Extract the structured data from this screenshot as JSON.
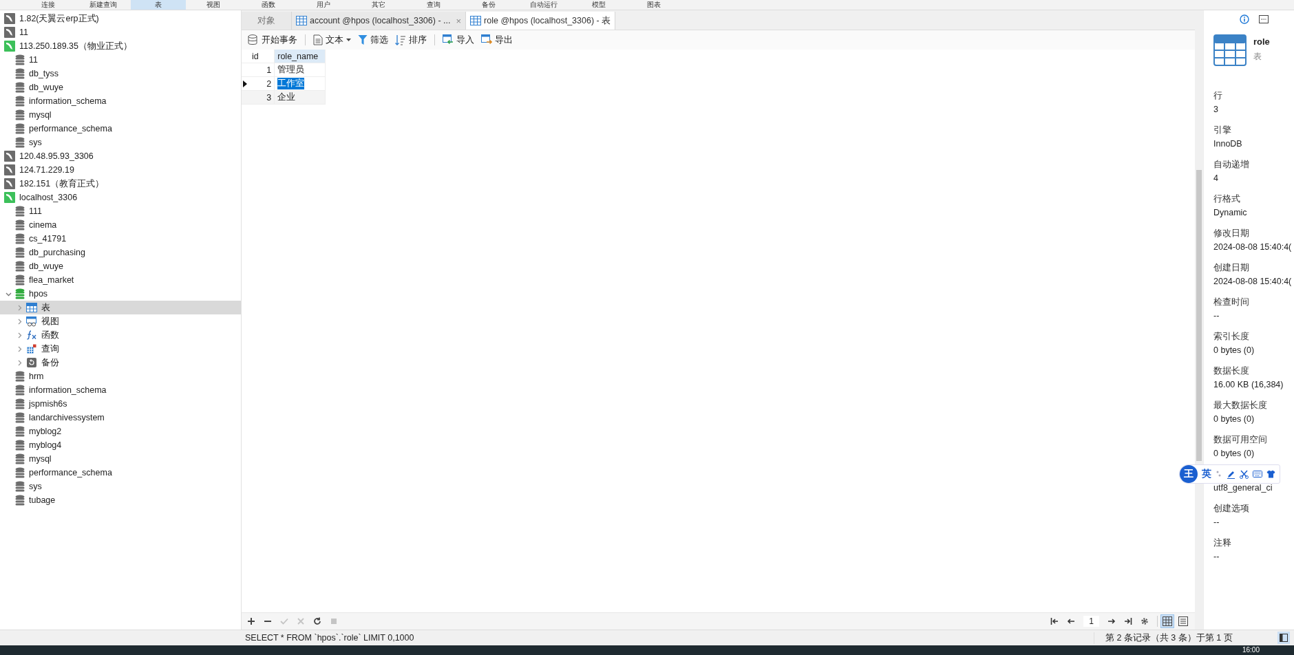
{
  "ribbon": [
    {
      "label": "连接",
      "selected": false
    },
    {
      "label": "新建查询",
      "selected": false
    },
    {
      "label": "表",
      "selected": true
    },
    {
      "label": "视图",
      "selected": false
    },
    {
      "label": "函数",
      "selected": false
    },
    {
      "label": "用户",
      "selected": false
    },
    {
      "label": "其它",
      "selected": false
    },
    {
      "label": "查询",
      "selected": false
    },
    {
      "label": "备份",
      "selected": false
    },
    {
      "label": "自动运行",
      "selected": false
    },
    {
      "label": "模型",
      "selected": false
    },
    {
      "label": "图表",
      "selected": false
    }
  ],
  "sidebar": {
    "items": [
      {
        "kind": "connection",
        "label": "1.82(天翼云erp正式)",
        "connected": false
      },
      {
        "kind": "connection",
        "label": "11",
        "connected": false
      },
      {
        "kind": "connection",
        "label": "113.250.189.35（物业正式）",
        "connected": true,
        "children": [
          {
            "kind": "database",
            "label": "11",
            "open": false
          },
          {
            "kind": "database",
            "label": "db_tyss",
            "open": false
          },
          {
            "kind": "database",
            "label": "db_wuye",
            "open": false
          },
          {
            "kind": "database",
            "label": "information_schema",
            "open": false
          },
          {
            "kind": "database",
            "label": "mysql",
            "open": false
          },
          {
            "kind": "database",
            "label": "performance_schema",
            "open": false
          },
          {
            "kind": "database",
            "label": "sys",
            "open": false
          }
        ]
      },
      {
        "kind": "connection",
        "label": "120.48.95.93_3306",
        "connected": false
      },
      {
        "kind": "connection",
        "label": "124.71.229.19",
        "connected": false
      },
      {
        "kind": "connection",
        "label": "182.151（教育正式）",
        "connected": false
      },
      {
        "kind": "connection",
        "label": "localhost_3306",
        "connected": true,
        "children": [
          {
            "kind": "database",
            "label": "111",
            "open": false
          },
          {
            "kind": "database",
            "label": "cinema",
            "open": false
          },
          {
            "kind": "database",
            "label": "cs_41791",
            "open": false
          },
          {
            "kind": "database",
            "label": "db_purchasing",
            "open": false
          },
          {
            "kind": "database",
            "label": "db_wuye",
            "open": false
          },
          {
            "kind": "database",
            "label": "flea_market",
            "open": false
          },
          {
            "kind": "database",
            "label": "hpos",
            "open": true,
            "expanded": true,
            "children": [
              {
                "kind": "tables",
                "label": "表",
                "expanded": false,
                "selected": true
              },
              {
                "kind": "views",
                "label": "视图",
                "expanded": false,
                "selected": false
              },
              {
                "kind": "functions",
                "label": "函数",
                "expanded": false,
                "selected": false
              },
              {
                "kind": "queries",
                "label": "查询",
                "expanded": false,
                "selected": false
              },
              {
                "kind": "backups",
                "label": "备份",
                "expanded": false,
                "selected": false
              }
            ]
          },
          {
            "kind": "database",
            "label": "hrm",
            "open": false
          },
          {
            "kind": "database",
            "label": "information_schema",
            "open": false
          },
          {
            "kind": "database",
            "label": "jspmish6s",
            "open": false
          },
          {
            "kind": "database",
            "label": "landarchivessystem",
            "open": false
          },
          {
            "kind": "database",
            "label": "myblog2",
            "open": false
          },
          {
            "kind": "database",
            "label": "myblog4",
            "open": false
          },
          {
            "kind": "database",
            "label": "mysql",
            "open": false
          },
          {
            "kind": "database",
            "label": "performance_schema",
            "open": false
          },
          {
            "kind": "database",
            "label": "sys",
            "open": false
          },
          {
            "kind": "database",
            "label": "tubage",
            "open": false
          }
        ]
      }
    ]
  },
  "tabs": [
    {
      "kind": "objects",
      "label": "对象",
      "selected": false
    },
    {
      "kind": "table",
      "label": "account @hpos (localhost_3306) - ...",
      "selected": false,
      "close": "×"
    },
    {
      "kind": "table",
      "label": "role @hpos (localhost_3306) - 表",
      "selected": true
    }
  ],
  "toolbar": [
    {
      "kind": "transaction",
      "label": "开始事务"
    },
    {
      "kind": "text",
      "label": "文本",
      "dropdown": true
    },
    {
      "kind": "filter",
      "label": "筛选"
    },
    {
      "kind": "sort",
      "label": "排序"
    },
    {
      "kind": "import",
      "label": "导入"
    },
    {
      "kind": "export",
      "label": "导出"
    }
  ],
  "table": {
    "columns": [
      "id",
      "role_name"
    ],
    "rows": [
      {
        "id": "1",
        "role_name": "管理员",
        "selected": false
      },
      {
        "id": "2",
        "role_name": "工作室",
        "selected": true
      },
      {
        "id": "3",
        "role_name": "企业",
        "selected": false
      }
    ]
  },
  "grid_toolbar": [
    {
      "kind": "add",
      "disabled": false
    },
    {
      "kind": "remove",
      "disabled": false
    },
    {
      "kind": "apply",
      "disabled": true
    },
    {
      "kind": "cancel",
      "disabled": true
    },
    {
      "kind": "refresh",
      "disabled": false
    },
    {
      "kind": "stop",
      "disabled": true
    }
  ],
  "pager": {
    "page": "1",
    "views": [
      {
        "kind": "grid",
        "selected": true
      },
      {
        "kind": "form",
        "selected": false
      }
    ]
  },
  "info_panel": {
    "title": "role",
    "subtitle": "表",
    "properties": [
      {
        "label": "行",
        "value": "3"
      },
      {
        "label": "引擎",
        "value": "InnoDB"
      },
      {
        "label": "自动递增",
        "value": "4"
      },
      {
        "label": "行格式",
        "value": "Dynamic"
      },
      {
        "label": "修改日期",
        "value": "2024-08-08 15:40:4("
      },
      {
        "label": "创建日期",
        "value": "2024-08-08 15:40:4("
      },
      {
        "label": "检查时间",
        "value": "--"
      },
      {
        "label": "索引长度",
        "value": "0 bytes (0)"
      },
      {
        "label": "数据长度",
        "value": "16.00 KB (16,384)"
      },
      {
        "label": "最大数据长度",
        "value": "0 bytes (0)"
      },
      {
        "label": "数据可用空间",
        "value": "0 bytes (0)"
      },
      {
        "value": "utf8_general_ci"
      },
      {
        "label": "创建选项",
        "value": "--"
      },
      {
        "label": "注释",
        "value": "--"
      }
    ]
  },
  "ime_bar": {
    "logo": "王",
    "mode": "英"
  },
  "status_bar": {
    "sql": "SELECT * FROM `hpos`.`role` LIMIT 0,1000",
    "records": "第 2 条记录（共 3 条）于第 1 页"
  },
  "taskbar": {
    "clock": "16:00"
  }
}
